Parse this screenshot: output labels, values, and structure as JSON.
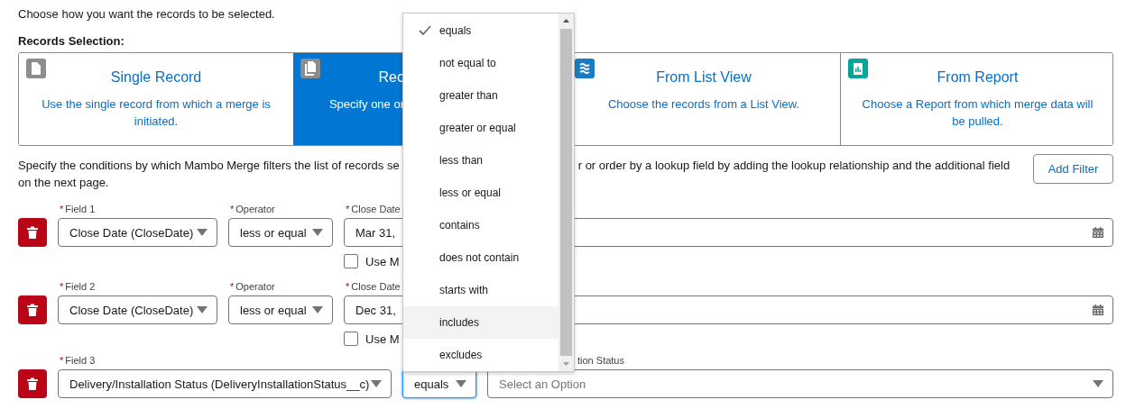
{
  "intro": "Choose how you want the records to be selected.",
  "selection_label": "Records Selection:",
  "record_options": [
    {
      "kind": "single",
      "title": "Single Record",
      "description": "Use the single record from which a merge is initiated.",
      "selected": false
    },
    {
      "kind": "multiple",
      "title": "Rec",
      "description": "Specify one or",
      "selected": true
    },
    {
      "kind": "list_view",
      "title": "From List View",
      "description": "Choose the records from a List View.",
      "selected": false
    },
    {
      "kind": "report",
      "title": "From Report",
      "description": "Choose a Report from which merge data will be pulled.",
      "selected": false
    }
  ],
  "conditions_text": {
    "left": "Specify the conditions by which Mambo Merge filters the list of records se",
    "right": "r or order by a lookup field by adding the lookup relationship and the additional field",
    "line_2": "on the next page."
  },
  "add_filter_button": "Add Filter",
  "filters": [
    {
      "kind": "date",
      "field_label": {
        "mark": "*",
        "text": "Field 1"
      },
      "field": "Close Date (CloseDate)",
      "operator_label": {
        "mark": "*",
        "text": "Operator"
      },
      "operator": "less or equal",
      "operator_focused": false,
      "value_label": {
        "mark": "*",
        "text": "Close Date"
      },
      "value": "Mar 31,",
      "checkbox": {
        "label": "Use M",
        "checked": false
      }
    },
    {
      "kind": "date",
      "field_label": {
        "mark": "*",
        "text": "Field 2"
      },
      "field": "Close Date (CloseDate)",
      "operator_label": {
        "mark": "*",
        "text": "Operator"
      },
      "operator": "less or equal",
      "operator_focused": false,
      "value_label": {
        "mark": "*",
        "text": "Close Date"
      },
      "value": "Dec 31,",
      "checkbox": {
        "label": "Use M",
        "checked": false
      }
    },
    {
      "kind": "picklist",
      "field_label": {
        "mark": "*",
        "text": "Field 3"
      },
      "field": "Delivery/Installation Status (DeliveryInstallationStatus__c)",
      "operator": "equals",
      "operator_focused": true,
      "value_label": {
        "text": "tion Status"
      },
      "placeholder": "Select an Option"
    }
  ],
  "operator_menu": {
    "items": [
      {
        "label": "equals",
        "selected": true,
        "highlighted": false
      },
      {
        "label": "not equal to",
        "selected": false,
        "highlighted": false
      },
      {
        "label": "greater than",
        "selected": false,
        "highlighted": false
      },
      {
        "label": "greater or equal",
        "selected": false,
        "highlighted": false
      },
      {
        "label": "less than",
        "selected": false,
        "highlighted": false
      },
      {
        "label": "less or equal",
        "selected": false,
        "highlighted": false
      },
      {
        "label": "contains",
        "selected": false,
        "highlighted": false
      },
      {
        "label": "does not contain",
        "selected": false,
        "highlighted": false
      },
      {
        "label": "starts with",
        "selected": false,
        "highlighted": false
      },
      {
        "label": "includes",
        "selected": false,
        "highlighted": true
      },
      {
        "label": "excludes",
        "selected": false,
        "highlighted": false
      }
    ]
  }
}
